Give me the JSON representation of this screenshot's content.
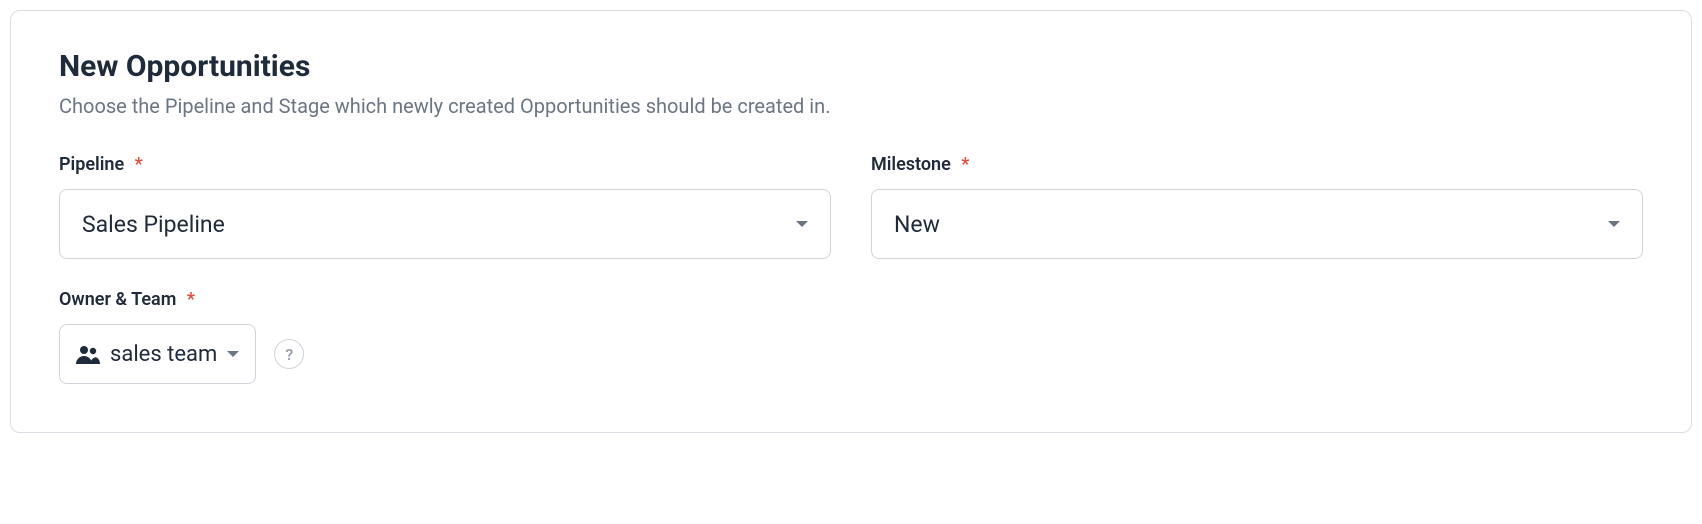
{
  "section": {
    "title": "New Opportunities",
    "subtitle": "Choose the Pipeline and Stage which newly created Opportunities should be created in."
  },
  "fields": {
    "pipeline": {
      "label": "Pipeline",
      "required_mark": "*",
      "value": "Sales Pipeline"
    },
    "milestone": {
      "label": "Milestone",
      "required_mark": "*",
      "value": "New"
    },
    "owner_team": {
      "label": "Owner & Team",
      "required_mark": "*",
      "value": "sales team",
      "help": "?"
    }
  }
}
